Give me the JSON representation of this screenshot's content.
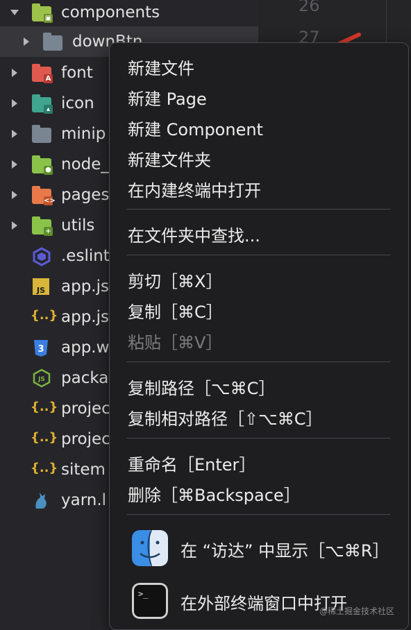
{
  "line_numbers": [
    "26",
    "27"
  ],
  "tree": [
    {
      "name": "components",
      "icon": "folder-components-icon",
      "expanded": true
    },
    {
      "name": "downBtn",
      "icon": "folder-icon",
      "selected": true
    },
    {
      "name": "font",
      "icon": "folder-font-icon"
    },
    {
      "name": "icon",
      "icon": "folder-images-icon"
    },
    {
      "name": "minip",
      "icon": "folder-icon"
    },
    {
      "name": "node_",
      "icon": "folder-node-icon"
    },
    {
      "name": "pages",
      "icon": "folder-pages-icon"
    },
    {
      "name": "utils",
      "icon": "folder-utils-icon"
    },
    {
      "name": ".eslint",
      "icon": "eslint-icon"
    },
    {
      "name": "app.js",
      "icon": "js-file-icon"
    },
    {
      "name": "app.js",
      "icon": "json-file-icon"
    },
    {
      "name": "app.w",
      "icon": "css-file-icon"
    },
    {
      "name": "packa",
      "icon": "node-file-icon"
    },
    {
      "name": "projec",
      "icon": "json-file-icon"
    },
    {
      "name": "projec",
      "icon": "json-file-icon"
    },
    {
      "name": "sitem",
      "icon": "json-file-icon"
    },
    {
      "name": "yarn.l",
      "icon": "yarn-icon"
    }
  ],
  "menu": {
    "group1": [
      "新建文件",
      "新建 Page",
      "新建 Component",
      "新建文件夹",
      "在内建终端中打开"
    ],
    "group2": [
      "在文件夹中查找..."
    ],
    "group3": [
      {
        "label": "剪切［⌘X］",
        "disabled": false
      },
      {
        "label": "复制［⌘C］",
        "disabled": false
      },
      {
        "label": "粘贴［⌘V］",
        "disabled": true
      }
    ],
    "group4": [
      "复制路径［⌥⌘C］",
      "复制相对路径［⇧⌥⌘C］"
    ],
    "group5": [
      "重命名［Enter］",
      "删除［⌘Backspace］"
    ],
    "group6": [
      {
        "label": "在 “访达” 中显示［⌥⌘R］",
        "icon": "finder-icon"
      },
      {
        "label": "在外部终端窗口中打开",
        "icon": "terminal-icon"
      }
    ]
  },
  "watermark": "@稀土掘金技术社区",
  "colors": {
    "arrow": "#d8382c",
    "menu_bg": "#1e1e20",
    "tree_bg": "#26262a"
  }
}
